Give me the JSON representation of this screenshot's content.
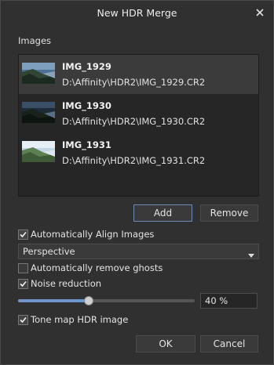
{
  "dialog": {
    "title": "New HDR Merge"
  },
  "images": {
    "section_label": "Images",
    "items": [
      {
        "name": "IMG_1929",
        "path": "D:\\Affinity\\HDR2\\IMG_1929.CR2"
      },
      {
        "name": "IMG_1930",
        "path": "D:\\Affinity\\HDR2\\IMG_1930.CR2"
      },
      {
        "name": "IMG_1931",
        "path": "D:\\Affinity\\HDR2\\IMG_1931.CR2"
      }
    ],
    "add_label": "Add",
    "remove_label": "Remove"
  },
  "options": {
    "align_label": "Automatically Align Images",
    "align_checked": true,
    "align_mode": "Perspective",
    "ghosts_label": "Automatically remove ghosts",
    "ghosts_checked": false,
    "noise_label": "Noise reduction",
    "noise_checked": true,
    "noise_value": "40 %",
    "noise_fraction": 0.4,
    "tonemap_label": "Tone map HDR image",
    "tonemap_checked": true
  },
  "footer": {
    "ok_label": "OK",
    "cancel_label": "Cancel"
  },
  "colors": {
    "accent": "#6e95cc",
    "background": "#303030"
  }
}
